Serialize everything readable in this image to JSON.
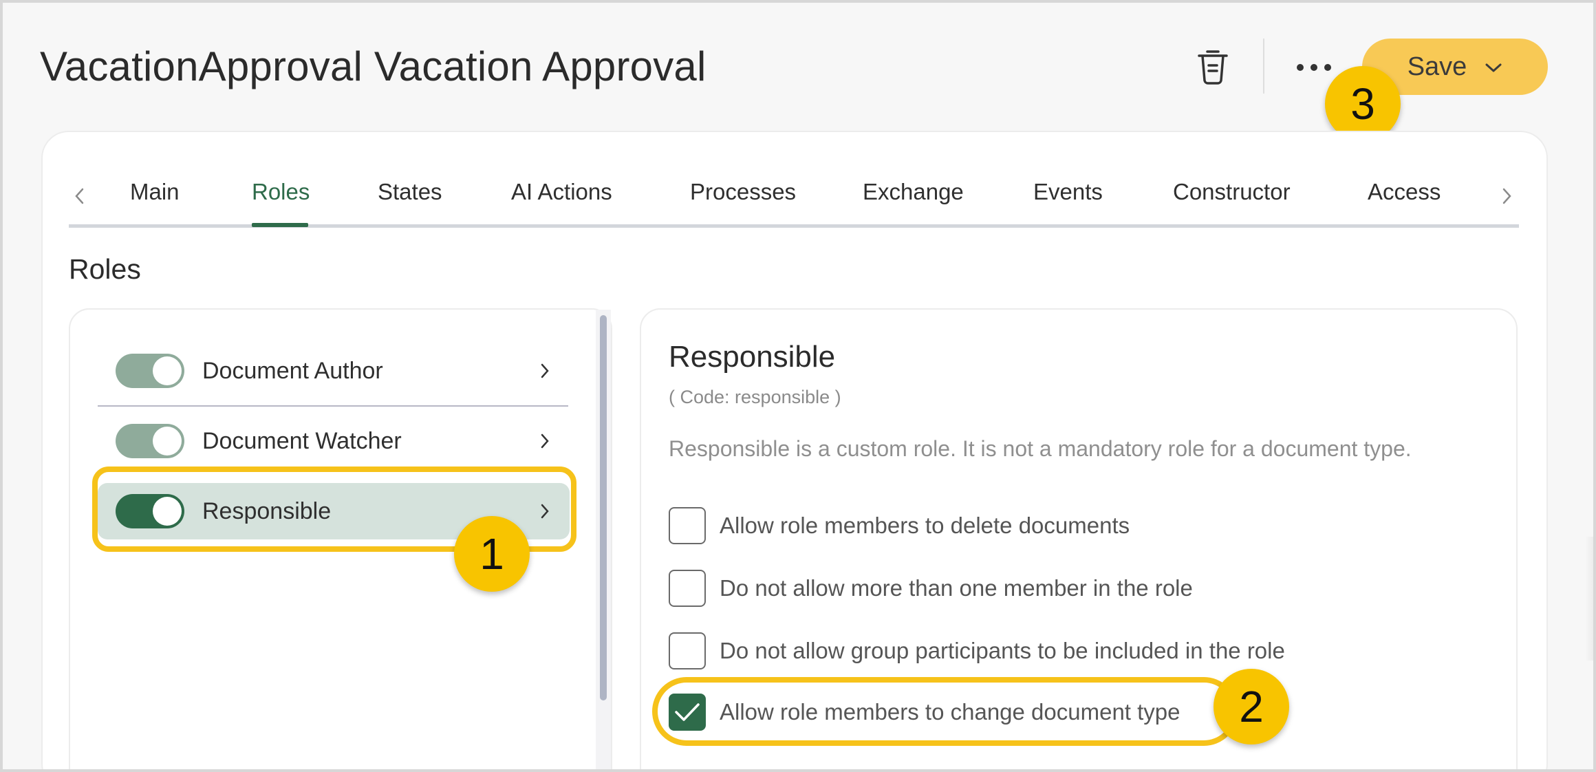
{
  "header": {
    "title": "VacationApproval Vacation Approval",
    "delete_icon": "trash-icon",
    "more_icon": "more-horizontal-icon",
    "save_label": "Save"
  },
  "tabs": [
    {
      "label": "Main",
      "active": false
    },
    {
      "label": "Roles",
      "active": true
    },
    {
      "label": "States",
      "active": false
    },
    {
      "label": "AI Actions",
      "active": false
    },
    {
      "label": "Processes",
      "active": false
    },
    {
      "label": "Exchange",
      "active": false
    },
    {
      "label": "Events",
      "active": false
    },
    {
      "label": "Constructor",
      "active": false
    },
    {
      "label": "Access",
      "active": false
    }
  ],
  "section_title": "Roles",
  "roles": [
    {
      "label": "Document Author",
      "enabled": true
    },
    {
      "label": "Document Watcher",
      "enabled": true
    },
    {
      "label": "Responsible",
      "enabled": true,
      "selected": true
    }
  ],
  "detail": {
    "title": "Responsible",
    "code": "( Code: responsible )",
    "description": "Responsible is a custom role. It is not a mandatory role for a document type.",
    "options": [
      {
        "label": "Allow role members to delete documents",
        "checked": false
      },
      {
        "label": "Do not allow more than one member in the role",
        "checked": false
      },
      {
        "label": "Do not allow group participants to be included in the role",
        "checked": false
      },
      {
        "label": "Allow role members to change document type",
        "checked": true
      }
    ]
  },
  "annotations": {
    "step1": "1",
    "step2": "2",
    "step3": "3"
  },
  "colors": {
    "accent_green": "#2e6b4a",
    "save_yellow": "#f8c955",
    "highlight_yellow": "#f6c21a"
  }
}
